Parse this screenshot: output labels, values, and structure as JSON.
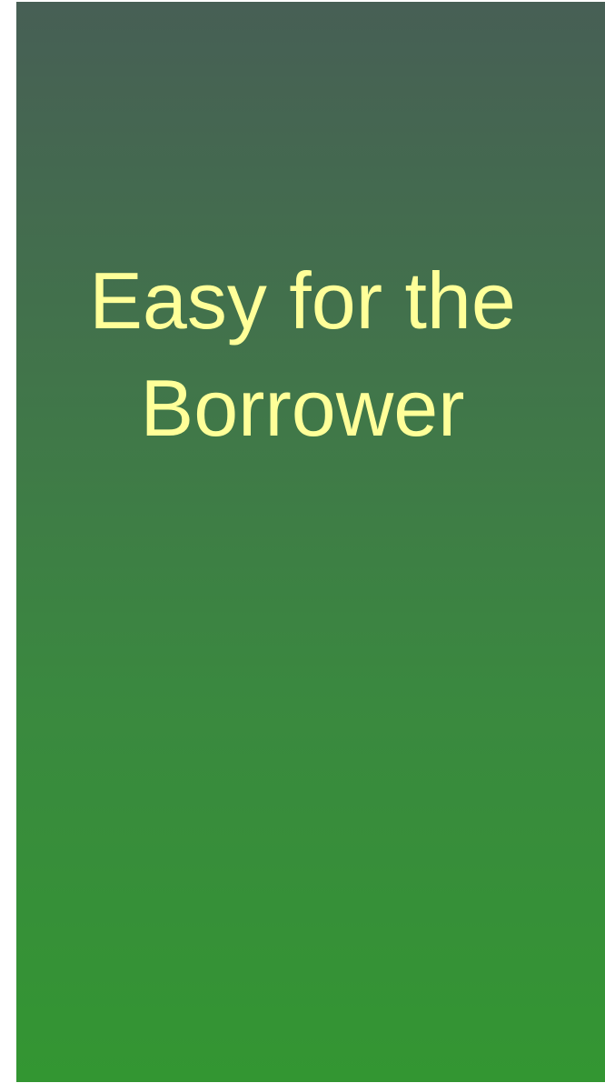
{
  "slide": {
    "title_lines": [
      "Easy for the",
      "Borrower"
    ]
  },
  "colors": {
    "background_top": "#475f55",
    "background_bottom": "#339632",
    "title_text": "#ffff99"
  }
}
